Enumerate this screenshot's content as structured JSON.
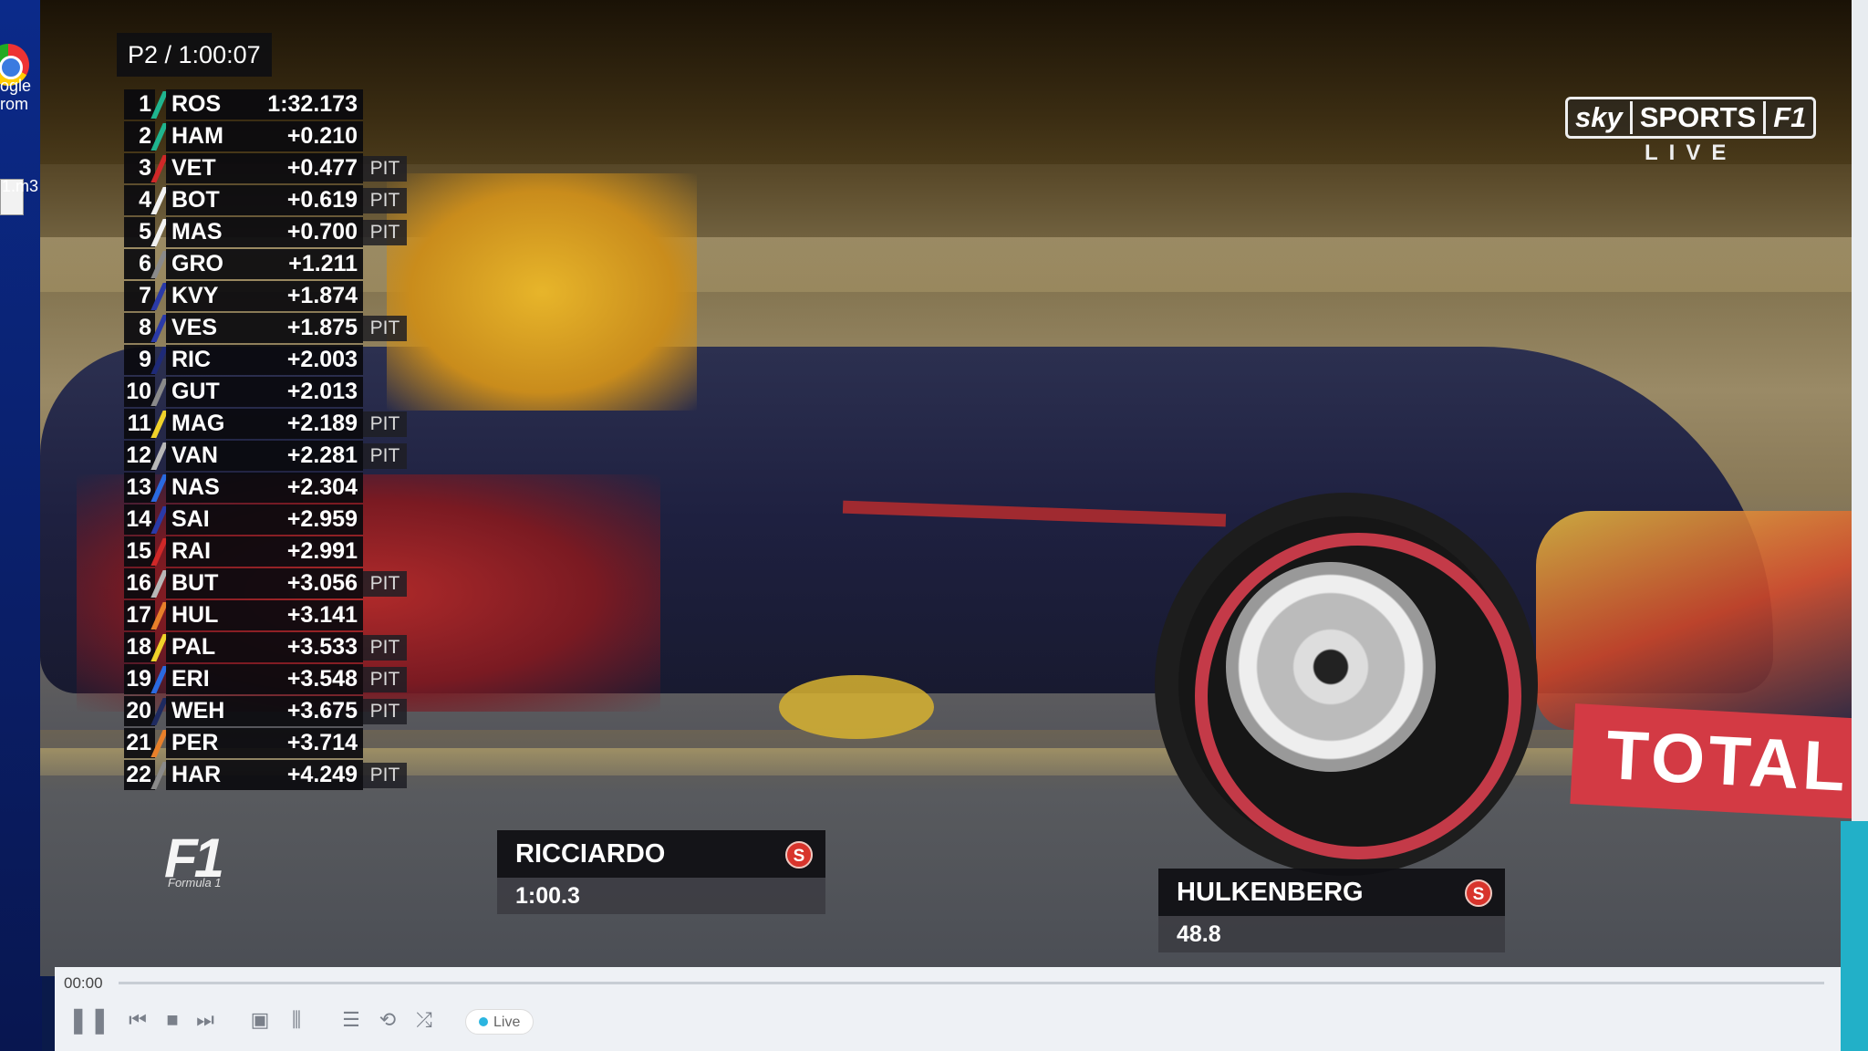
{
  "desktop": {
    "icons": [
      {
        "label_line1": "ogle",
        "label_line2": "rom"
      },
      {
        "label_line1": "1.m3"
      }
    ]
  },
  "broadcast": {
    "session": "P2 / 1:00:07",
    "standings": [
      {
        "pos": "1",
        "code": "ROS",
        "gap": "1:32.173",
        "status": "",
        "team_color": "#1fb58f"
      },
      {
        "pos": "2",
        "code": "HAM",
        "gap": "+0.210",
        "status": "",
        "team_color": "#1fb58f"
      },
      {
        "pos": "3",
        "code": "VET",
        "gap": "+0.477",
        "status": "PIT",
        "team_color": "#d02828"
      },
      {
        "pos": "4",
        "code": "BOT",
        "gap": "+0.619",
        "status": "PIT",
        "team_color": "#f2f2f2"
      },
      {
        "pos": "5",
        "code": "MAS",
        "gap": "+0.700",
        "status": "PIT",
        "team_color": "#f2f2f2"
      },
      {
        "pos": "6",
        "code": "GRO",
        "gap": "+1.211",
        "status": "",
        "team_color": "#8a8a8a"
      },
      {
        "pos": "7",
        "code": "KVY",
        "gap": "+1.874",
        "status": "",
        "team_color": "#2a3aa8"
      },
      {
        "pos": "8",
        "code": "VES",
        "gap": "+1.875",
        "status": "PIT",
        "team_color": "#2a3aa8"
      },
      {
        "pos": "9",
        "code": "RIC",
        "gap": "+2.003",
        "status": "",
        "team_color": "#1e2a78"
      },
      {
        "pos": "10",
        "code": "GUT",
        "gap": "+2.013",
        "status": "",
        "team_color": "#8a8a8a"
      },
      {
        "pos": "11",
        "code": "MAG",
        "gap": "+2.189",
        "status": "PIT",
        "team_color": "#f0d22a"
      },
      {
        "pos": "12",
        "code": "VAN",
        "gap": "+2.281",
        "status": "PIT",
        "team_color": "#b8b8b8"
      },
      {
        "pos": "13",
        "code": "NAS",
        "gap": "+2.304",
        "status": "",
        "team_color": "#2a6ae0"
      },
      {
        "pos": "14",
        "code": "SAI",
        "gap": "+2.959",
        "status": "",
        "team_color": "#2a3aa8"
      },
      {
        "pos": "15",
        "code": "RAI",
        "gap": "+2.991",
        "status": "",
        "team_color": "#d02828"
      },
      {
        "pos": "16",
        "code": "BUT",
        "gap": "+3.056",
        "status": "PIT",
        "team_color": "#b8b8b8"
      },
      {
        "pos": "17",
        "code": "HUL",
        "gap": "+3.141",
        "status": "",
        "team_color": "#e8802a"
      },
      {
        "pos": "18",
        "code": "PAL",
        "gap": "+3.533",
        "status": "PIT",
        "team_color": "#f0d22a"
      },
      {
        "pos": "19",
        "code": "ERI",
        "gap": "+3.548",
        "status": "PIT",
        "team_color": "#2a6ae0"
      },
      {
        "pos": "20",
        "code": "WEH",
        "gap": "+3.675",
        "status": "PIT",
        "team_color": "#1e2a60"
      },
      {
        "pos": "21",
        "code": "PER",
        "gap": "+3.714",
        "status": "",
        "team_color": "#e8802a"
      },
      {
        "pos": "22",
        "code": "HAR",
        "gap": "+4.249",
        "status": "PIT",
        "team_color": "#8a8a8a"
      }
    ],
    "f1_logo_text": "F1",
    "f1_logo_sub": "Formula 1",
    "broadcaster": {
      "sky": "sky",
      "sports": "SPORTS",
      "f1": "F1",
      "live": "LIVE"
    },
    "sponsor_text": "TOTAL",
    "driver_tags": [
      {
        "name": "RICCIARDO",
        "time": "1:00.3",
        "tyre": "S",
        "tyre_color": "#d8342c"
      },
      {
        "name": "HULKENBERG",
        "time": "48.8",
        "tyre": "S",
        "tyre_color": "#d8342c"
      }
    ]
  },
  "player": {
    "timecode": "00:00",
    "live_label": "Live",
    "controls": [
      "pause-icon",
      "prev-icon",
      "stop-icon",
      "next-icon",
      "fullscreen-icon",
      "equalizer-icon",
      "playlist-icon",
      "repeat-icon",
      "shuffle-icon"
    ]
  }
}
